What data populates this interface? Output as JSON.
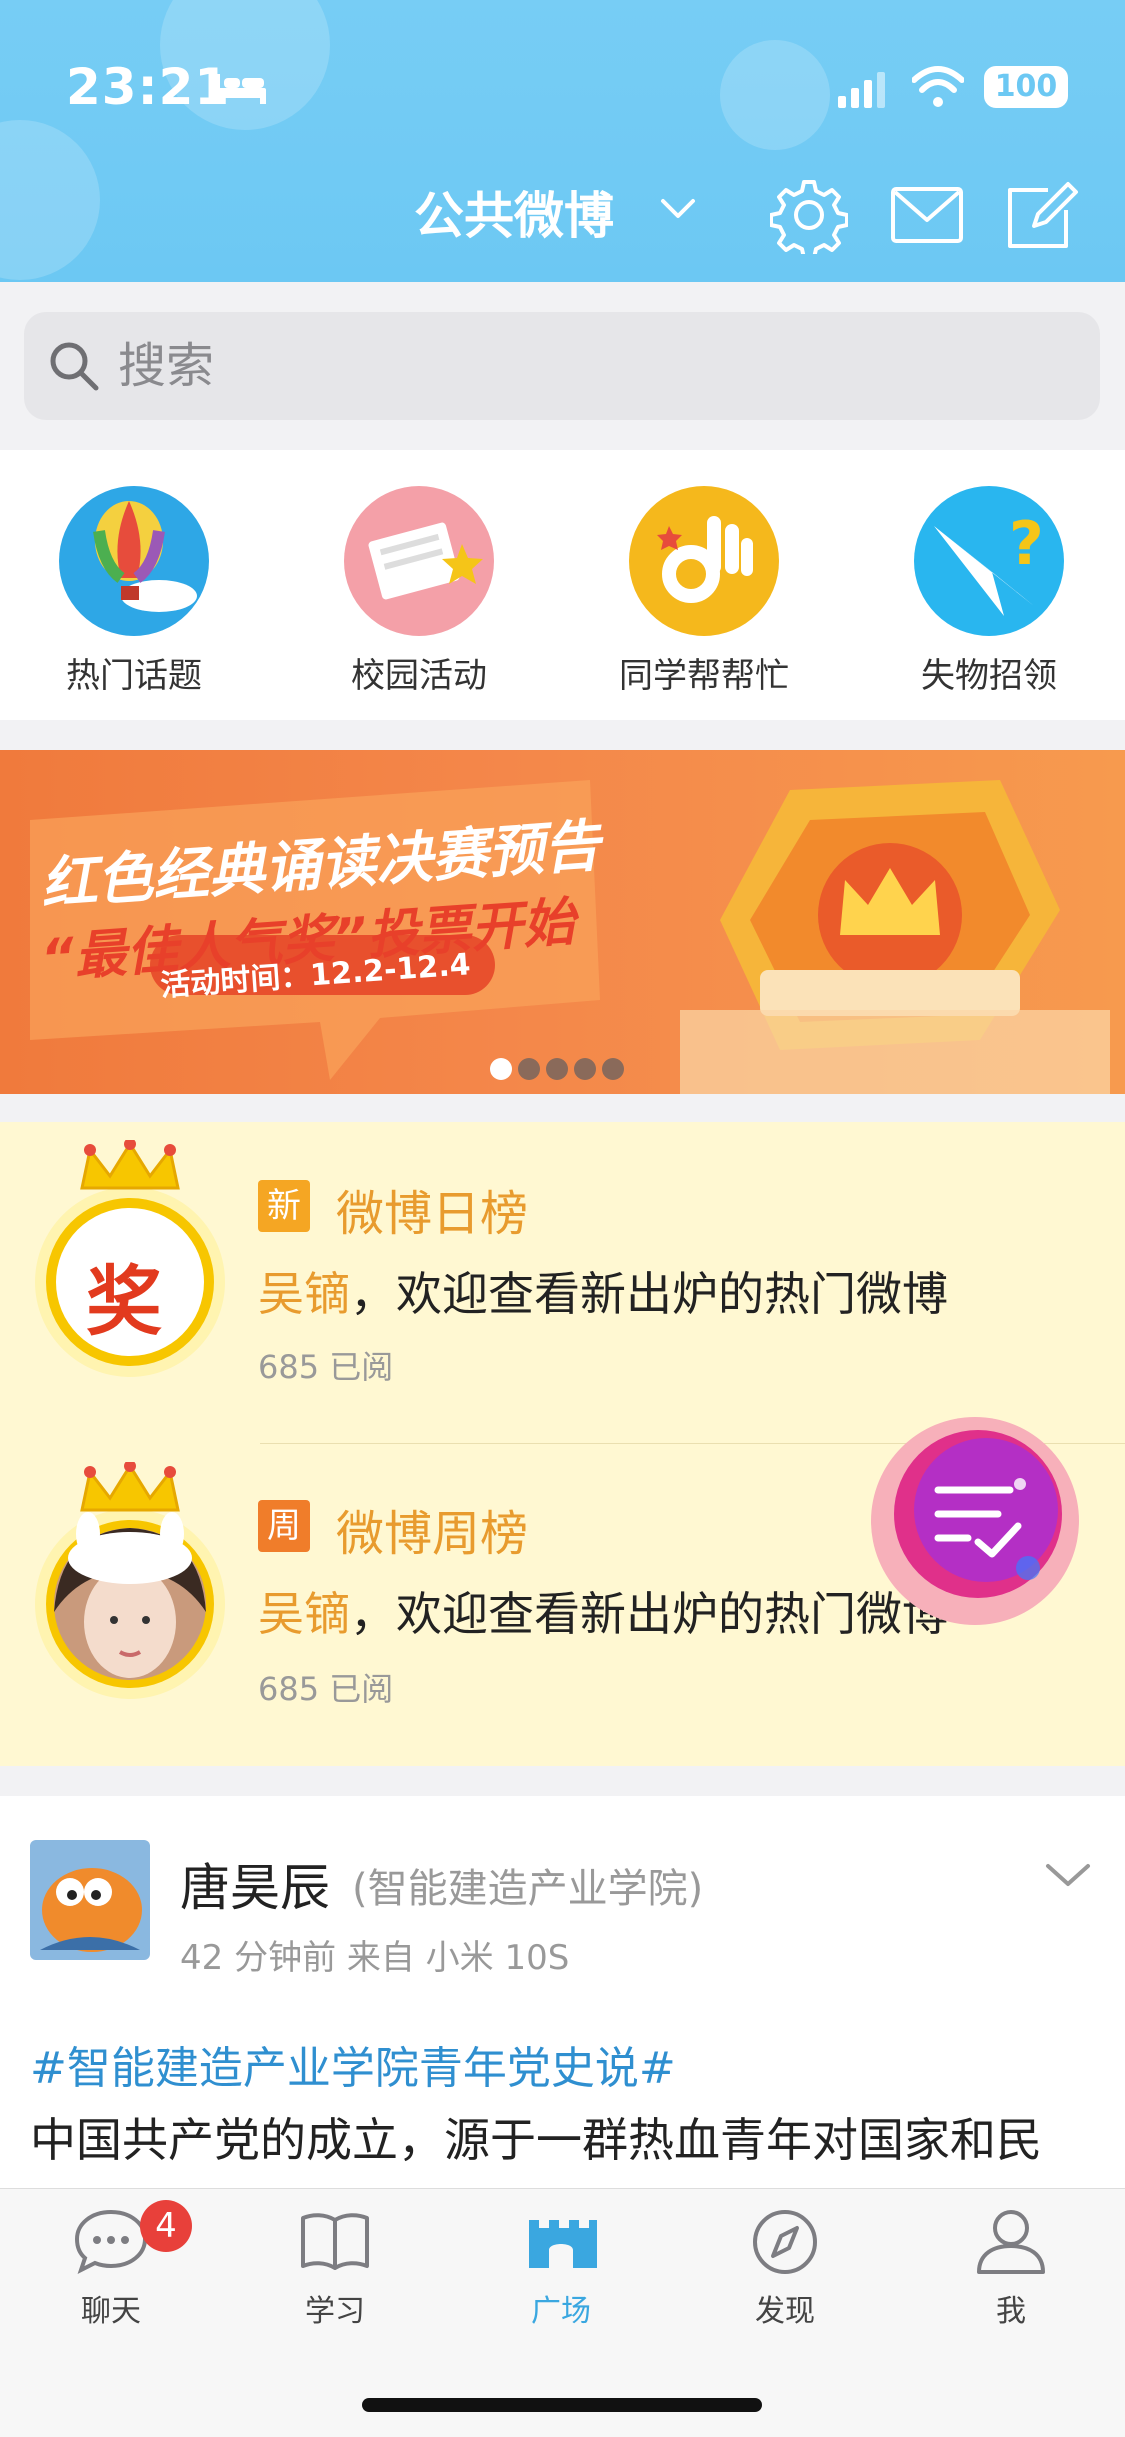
{
  "status_bar": {
    "time": "23:21",
    "battery": "100"
  },
  "header": {
    "title": "公共微博"
  },
  "search": {
    "placeholder": "搜索"
  },
  "quick_menu": [
    {
      "label": "热门话题",
      "icon": "hot-air-balloon-icon"
    },
    {
      "label": "校园活动",
      "icon": "paper-star-icon"
    },
    {
      "label": "同学帮帮忙",
      "icon": "ok-hand-icon"
    },
    {
      "label": "失物招领",
      "icon": "question-paper-plane-icon"
    }
  ],
  "banner": {
    "headline": "红色经典诵读决赛预告",
    "subline": "“最佳人气奖”投票开始",
    "period": "活动时间：12.2-12.4",
    "dots_total": 5,
    "dots_active": 1
  },
  "rankings": [
    {
      "badge": "新",
      "badge_color": "#f5a623",
      "title": "微博日榜",
      "name": "吴镝",
      "text": "，欢迎查看新出炉的热门微博",
      "reads": "685 已阅",
      "avatar_text": "奖"
    },
    {
      "badge": "周",
      "badge_color": "#f07d2a",
      "title": "微博周榜",
      "name": "吴镝",
      "text": "，欢迎查看新出炉的热门微博",
      "reads": "685 已阅"
    }
  ],
  "post": {
    "author": "唐昊辰",
    "affiliation": "(智能建造产业学院)",
    "meta": "42 分钟前 来自 小米 10S",
    "hashtag": "#智能建造产业学院青年党史说#",
    "body": "中国共产党的成立，源于一群热血青年对国家和民"
  },
  "tab_bar": [
    {
      "label": "聊天",
      "icon": "chat-bubble-icon",
      "badge": "4",
      "active": false
    },
    {
      "label": "学习",
      "icon": "open-book-icon",
      "active": false
    },
    {
      "label": "广场",
      "icon": "castle-icon",
      "active": true
    },
    {
      "label": "发现",
      "icon": "compass-icon",
      "active": false
    },
    {
      "label": "我",
      "icon": "person-icon",
      "active": false
    }
  ],
  "colors": {
    "header": "#6cc8f3",
    "accent": "#e89b2e",
    "link": "#2f8fd0",
    "tab_active": "#3aa7e0"
  }
}
